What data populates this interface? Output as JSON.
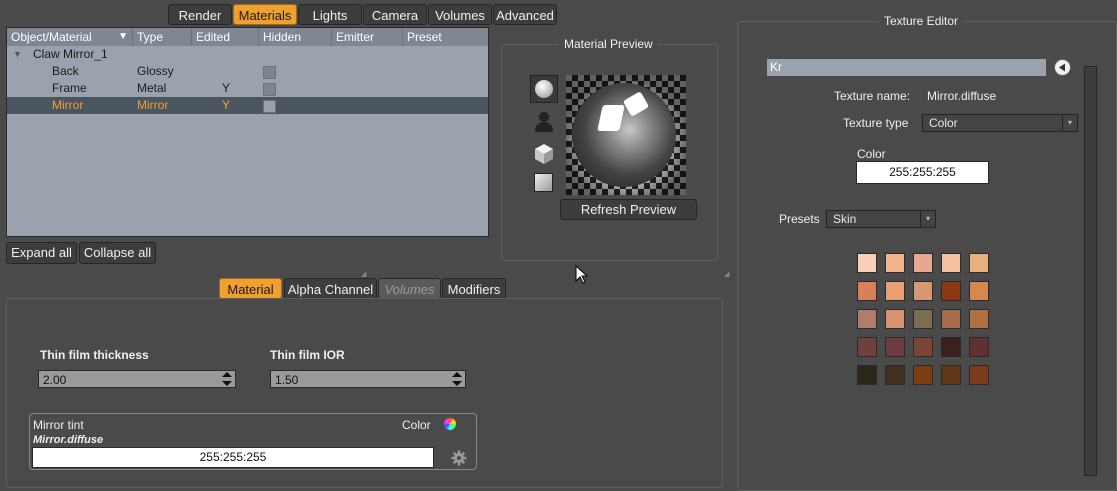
{
  "top_tabs": [
    "Render",
    "Materials",
    "Lights",
    "Camera",
    "Volumes",
    "Advanced"
  ],
  "table": {
    "headers": [
      "Object/Material",
      "Type",
      "Edited",
      "Hidden",
      "Emitter",
      "Preset"
    ],
    "group": "Claw Mirror_1",
    "rows": [
      {
        "name": "Back",
        "type": "Glossy",
        "edited": ""
      },
      {
        "name": "Frame",
        "type": "Metal",
        "edited": "Y"
      },
      {
        "name": "Mirror",
        "type": "Mirror",
        "edited": "Y"
      }
    ]
  },
  "buttons": {
    "expand_all": "Expand all",
    "collapse_all": "Collapse all",
    "refresh_preview": "Refresh Preview"
  },
  "preview": {
    "title": "Material Preview"
  },
  "sub_tabs": [
    "Material",
    "Alpha Channel",
    "Volumes",
    "Modifiers"
  ],
  "material": {
    "thin_film_thickness_label": "Thin film thickness",
    "thin_film_thickness_value": "2.00",
    "thin_film_ior_label": "Thin film IOR",
    "thin_film_ior_value": "1.50",
    "mirror_tint_label": "Mirror tint",
    "mirror_tint_texture": "Mirror.diffuse",
    "mirror_tint_mode": "Color",
    "mirror_tint_value": "255:255:255"
  },
  "texture_editor": {
    "title": "Texture Editor",
    "channel": "Kr",
    "name_label": "Texture name:",
    "name_value": "Mirror.diffuse",
    "type_label": "Texture type",
    "type_value": "Color",
    "color_label": "Color",
    "color_value": "255:255:255",
    "presets_label": "Presets",
    "presets_value": "Skin"
  },
  "swatches": [
    [
      "#f8d0b8",
      "#f0b48c",
      "#e8a890",
      "#f4c0a0",
      "#e8b07c"
    ],
    [
      "#d8805c",
      "#e8a070",
      "#d89878",
      "#8c3814",
      "#d48a4c"
    ],
    [
      "#b07c6c",
      "#d89470",
      "#7c6c50",
      "#a46c4c",
      "#b07040"
    ],
    [
      "#70403c",
      "#6c3c40",
      "#7c4434",
      "#3c2020",
      "#603034"
    ],
    [
      "#2c2818",
      "#40301c",
      "#7c3c14",
      "#603818",
      "#7c3c1c"
    ]
  ]
}
